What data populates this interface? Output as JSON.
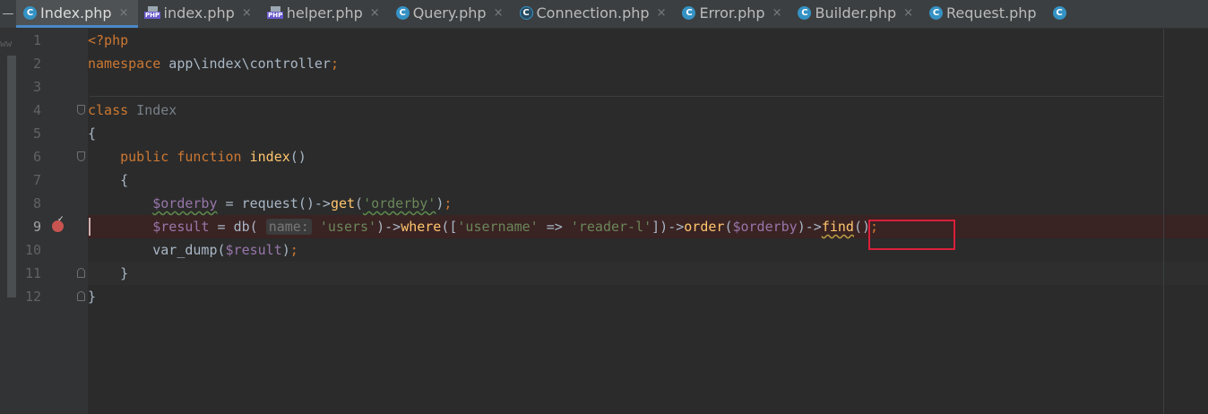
{
  "tabs": [
    {
      "name": "Index.php",
      "icon": "class-icon",
      "active": true
    },
    {
      "name": "index.php",
      "icon": "php-file-icon",
      "active": false
    },
    {
      "name": "helper.php",
      "icon": "php-file-icon",
      "active": false
    },
    {
      "name": "Query.php",
      "icon": "class-icon",
      "active": false
    },
    {
      "name": "Connection.php",
      "icon": "class-icon",
      "active": false
    },
    {
      "name": "Error.php",
      "icon": "class-icon",
      "active": false
    },
    {
      "name": "Builder.php",
      "icon": "class-icon",
      "active": false
    },
    {
      "name": "Request.php",
      "icon": "class-icon",
      "active": false
    }
  ],
  "tab_close_glyph": "×",
  "left_strip_text": "ww",
  "php_icon_label": "PHP",
  "class_icon_glyph": "C",
  "line_numbers": [
    "1",
    "2",
    "3",
    "4",
    "5",
    "6",
    "7",
    "8",
    "9",
    "10",
    "11",
    "12"
  ],
  "code": {
    "l1": {
      "open": "<?php"
    },
    "l2": {
      "kw": "namespace",
      "ns": " app\\index\\controller",
      "end": ";"
    },
    "l4": {
      "kw": "class",
      "name": " Index"
    },
    "l5": {
      "brace": "{"
    },
    "l6": {
      "indent": "    ",
      "kw1": "public",
      "kw2": " function",
      "fn": " index",
      "paren": "()"
    },
    "l7": {
      "indent": "    ",
      "brace": "{"
    },
    "l8": {
      "indent": "        ",
      "var": "$orderby",
      "eq": " = ",
      "fn1": "request",
      "p1": "()->",
      "fn2": "get",
      "p2": "(",
      "str": "'orderby'",
      "p3": ")",
      "end": ";"
    },
    "l9": {
      "indent": "        ",
      "var": "$result",
      "eq": " = ",
      "fn1": "db",
      "p1": "( ",
      "hint": "name:",
      "sp": " ",
      "str1": "'users'",
      "p2": ")->",
      "fn2": "where",
      "p3": "([",
      "str2": "'username'",
      "arrow": " => ",
      "str3": "'reader-l'",
      "p4": "])->",
      "fn3": "order",
      "p5": "(",
      "var2": "$orderby",
      "p6": ")->",
      "fn4": "find",
      "p7": "()",
      "end": ";"
    },
    "l10": {
      "indent": "        ",
      "fn": "var_dump",
      "p1": "(",
      "var": "$result",
      "p2": ")",
      "end": ";"
    },
    "l11": {
      "indent": "    ",
      "brace": "}"
    },
    "l12": {
      "brace": "}"
    }
  },
  "colors": {
    "keyword": "#cc7832",
    "function": "#ffc66d",
    "variable": "#9876aa",
    "string": "#6a8759",
    "text": "#a9b7c6",
    "highlight_box": "#d8203a",
    "breakpoint": "#c75450"
  }
}
